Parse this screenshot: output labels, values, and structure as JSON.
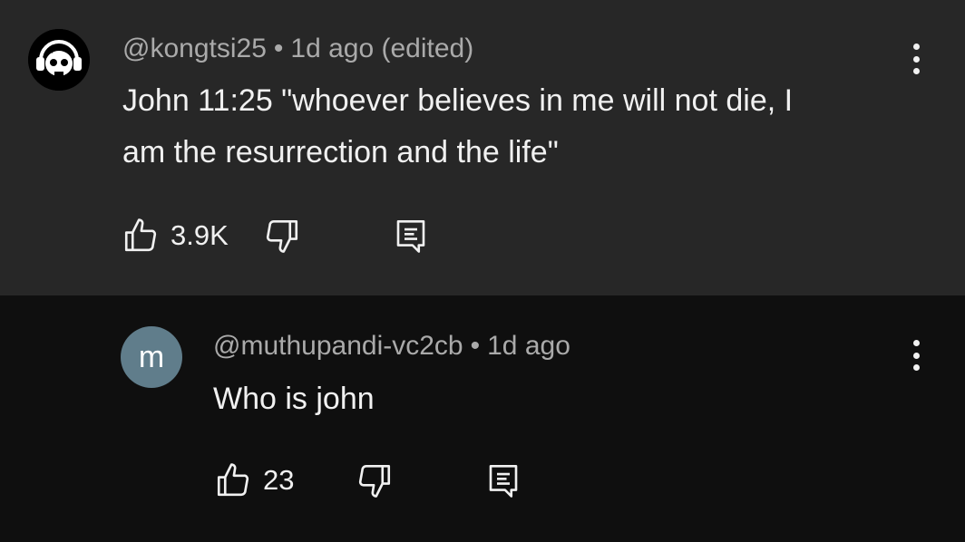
{
  "comments": [
    {
      "author": "@kongtsi25",
      "separator": "•",
      "time": "1d ago (edited)",
      "text_line1": "John 11:25 \"whoever believes in me will not die, I",
      "text_line2": "am the resurrection and the life\"",
      "likes": "3.9K",
      "avatar_icon": "headphone-skull-icon"
    },
    {
      "author": "@muthupandi-vc2cb",
      "separator": "•",
      "time": "1d ago",
      "text": "Who is john",
      "likes": "23",
      "avatar_letter": "m",
      "avatar_color": "#607d8b"
    }
  ],
  "colors": {
    "parent_bg": "#272727",
    "reply_bg": "#0f0f0f",
    "meta_text": "#aaaaaa",
    "body_text": "#f1f1f1"
  }
}
